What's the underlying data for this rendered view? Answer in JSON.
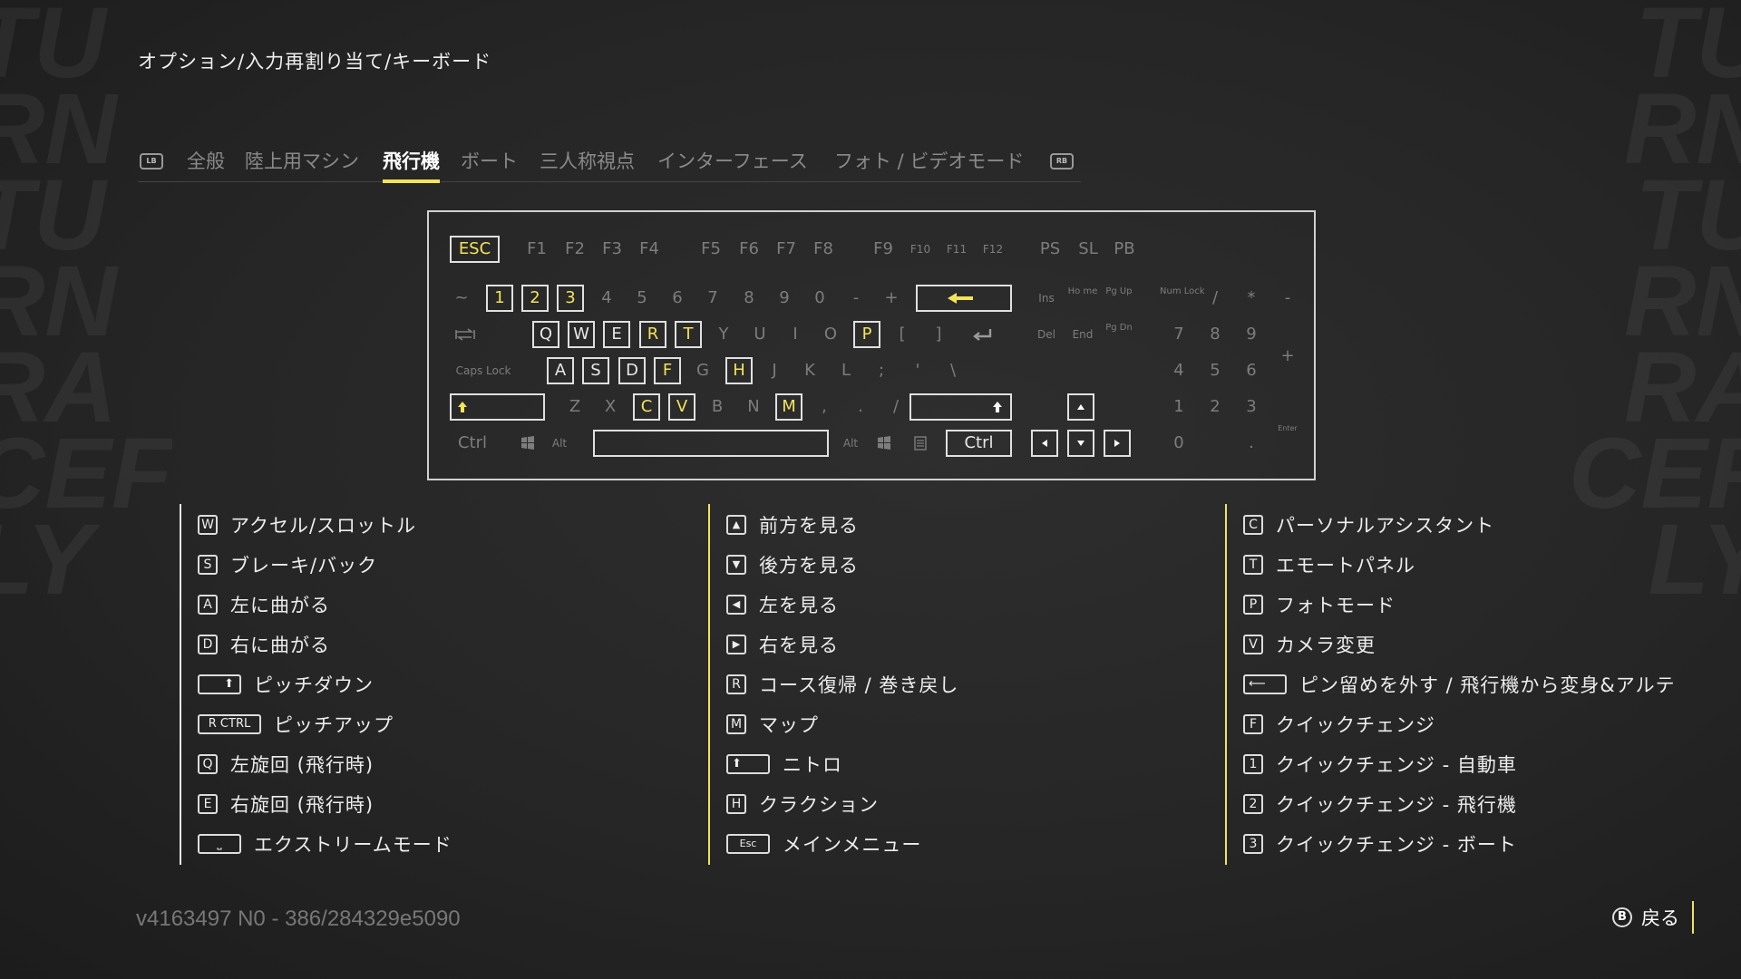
{
  "breadcrumb": "オプション/入力再割り当て/キーボード",
  "tabs": {
    "lb": "LB",
    "rb": "RB",
    "items": [
      "全般",
      "陸上用マシン",
      "飛行機",
      "ボート",
      "三人称視点",
      "インターフェース",
      "フォト / ビデオモード"
    ],
    "active_index": 2
  },
  "keyboard": {
    "esc": "ESC",
    "f": [
      "F1",
      "F2",
      "F3",
      "F4",
      "F5",
      "F6",
      "F7",
      "F8",
      "F9",
      "F10",
      "F11",
      "F12"
    ],
    "ps": "PS",
    "sl": "SL",
    "pb": "PB",
    "num_row": [
      "~",
      "1",
      "2",
      "3",
      "4",
      "5",
      "6",
      "7",
      "8",
      "9",
      "0",
      "-",
      "+"
    ],
    "q_row": [
      "Q",
      "W",
      "E",
      "R",
      "T",
      "Y",
      "U",
      "I",
      "O",
      "P",
      "[",
      "]"
    ],
    "a_row": [
      "A",
      "S",
      "D",
      "F",
      "G",
      "H",
      "J",
      "K",
      "L",
      ";",
      "'",
      "\\"
    ],
    "z_row": [
      "Z",
      "X",
      "C",
      "V",
      "B",
      "N",
      "M",
      ",",
      ".",
      "/"
    ],
    "caps": "Caps Lock",
    "ctrl_l": "Ctrl",
    "alt_l": "Alt",
    "alt_r": "Alt",
    "ctrl_r": "Ctrl",
    "ins": "Ins",
    "home": "Ho me",
    "pgup": "Pg Up",
    "del": "Del",
    "end": "End",
    "pgdn": "Pg Dn",
    "numlock": "Num Lock",
    "np_div": "/",
    "np_mul": "*",
    "np_sub": "-",
    "np7": "7",
    "np8": "8",
    "np9": "9",
    "np_add": "+",
    "np4": "4",
    "np5": "5",
    "np6": "6",
    "np1": "1",
    "np2": "2",
    "np3": "3",
    "np_enter": "Enter",
    "np0": "0",
    "np_dot": "."
  },
  "legend": {
    "col1": [
      {
        "key": "W",
        "label": "アクセル/スロットル"
      },
      {
        "key": "S",
        "label": "ブレーキ/バック"
      },
      {
        "key": "A",
        "label": "左に曲がる"
      },
      {
        "key": "D",
        "label": "右に曲がる"
      },
      {
        "key": "⬆",
        "label": "ピッチダウン"
      },
      {
        "key": "R CTRL",
        "label": "ピッチアップ"
      },
      {
        "key": "Q",
        "label": "左旋回 (飛行時)"
      },
      {
        "key": "E",
        "label": "右旋回 (飛行時)"
      },
      {
        "key": "⎵",
        "label": "エクストリームモード"
      }
    ],
    "col2": [
      {
        "key": "▲",
        "label": "前方を見る"
      },
      {
        "key": "▼",
        "label": "後方を見る"
      },
      {
        "key": "◀",
        "label": "左を見る"
      },
      {
        "key": "▶",
        "label": "右を見る"
      },
      {
        "key": "R",
        "label": "コース復帰 / 巻き戻し"
      },
      {
        "key": "M",
        "label": "マップ"
      },
      {
        "key": "⬆",
        "label": "ニトロ"
      },
      {
        "key": "H",
        "label": "クラクション"
      },
      {
        "key": "Esc",
        "label": "メインメニュー"
      }
    ],
    "col3": [
      {
        "key": "C",
        "label": "パーソナルアシスタント"
      },
      {
        "key": "T",
        "label": "エモートパネル"
      },
      {
        "key": "P",
        "label": "フォトモード"
      },
      {
        "key": "V",
        "label": "カメラ変更"
      },
      {
        "key": "⟵",
        "label": "ピン留めを外す / 飛行機から変身&アルテ"
      },
      {
        "key": "F",
        "label": "クイックチェンジ"
      },
      {
        "key": "1",
        "label": "クイックチェンジ - 自動車"
      },
      {
        "key": "2",
        "label": "クイックチェンジ - 飛行機"
      },
      {
        "key": "3",
        "label": "クイックチェンジ - ボート"
      }
    ]
  },
  "version": "v4163497 N0 - 386/284329e5090",
  "back": {
    "button": "B",
    "label": "戻る"
  },
  "colors": {
    "accent": "#f2e35a",
    "background": "#262626",
    "dim_key": "#7d7d7d"
  }
}
